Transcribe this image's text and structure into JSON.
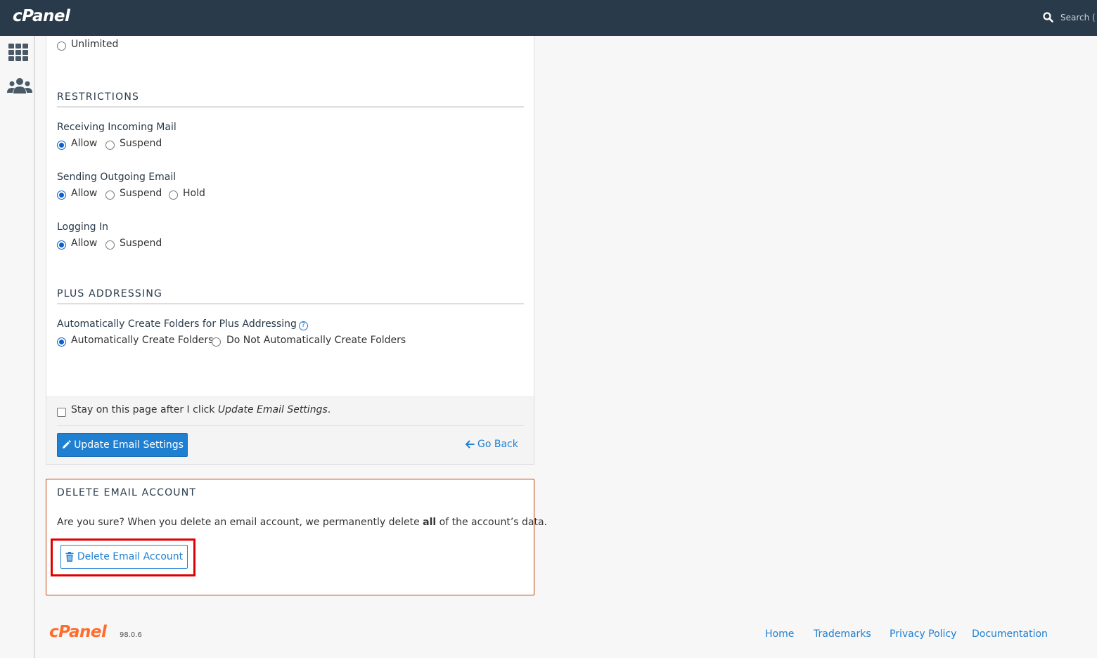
{
  "header": {
    "logo": "cPanel",
    "search_placeholder": "Search ( /"
  },
  "sidebar": {
    "icons": [
      "grid-icon",
      "users-icon"
    ]
  },
  "quota": {
    "unlimited_label": "Unlimited"
  },
  "restrictions": {
    "title": "RESTRICTIONS",
    "receiving": {
      "label": "Receiving Incoming Mail",
      "options": [
        "Allow",
        "Suspend"
      ],
      "selected": "Allow"
    },
    "sending": {
      "label": "Sending Outgoing Email",
      "options": [
        "Allow",
        "Suspend",
        "Hold"
      ],
      "selected": "Allow"
    },
    "login": {
      "label": "Logging In",
      "options": [
        "Allow",
        "Suspend"
      ],
      "selected": "Allow"
    }
  },
  "plus": {
    "title": "PLUS ADDRESSING",
    "label": "Automatically Create Folders for Plus Addressing",
    "options": [
      "Automatically Create Folders",
      "Do Not Automatically Create Folders"
    ],
    "selected": "Automatically Create Folders"
  },
  "actions": {
    "stay_text": "Stay on this page after I click ",
    "stay_em": "Update Email Settings",
    "stay_end": ".",
    "update_button": "Update Email Settings",
    "go_back": "Go Back"
  },
  "delete": {
    "title": "DELETE EMAIL ACCOUNT",
    "text_before": "Are you sure? When you delete an email account, we permanently delete ",
    "text_bold": "all",
    "text_after": " of the account’s data.",
    "button": "Delete Email Account"
  },
  "footer": {
    "logo": "cPanel",
    "version": "98.0.6",
    "links": [
      "Home",
      "Trademarks",
      "Privacy Policy",
      "Documentation"
    ]
  },
  "colors": {
    "topbar": "#293a4a",
    "accent": "#1f7fd1",
    "danger_border": "#c2410c",
    "highlight": "#e00000",
    "brand_orange": "#ff6c2c"
  }
}
